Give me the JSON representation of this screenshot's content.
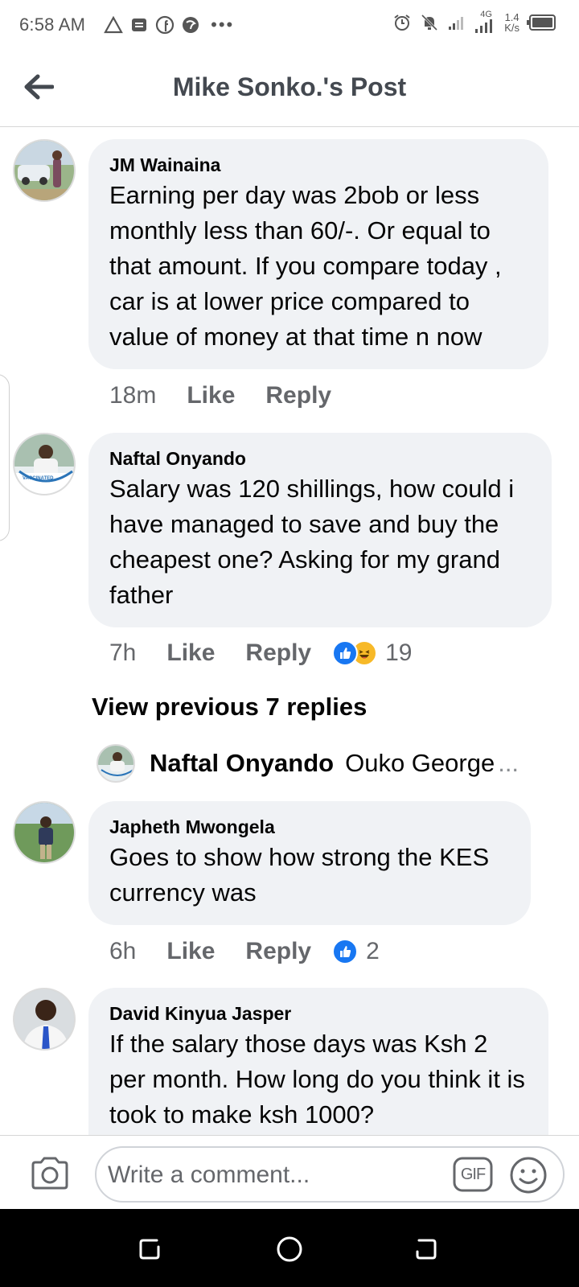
{
  "status_bar": {
    "time": "6:58 AM",
    "network": "4G",
    "speed_value": "1.4",
    "speed_unit": "K/s",
    "more": "•••"
  },
  "header": {
    "title": "Mike Sonko.'s Post"
  },
  "comments": [
    {
      "author": "JM Wainaina",
      "text": "Earning per day was 2bob or less monthly less than 60/-. Or equal to that amount. If you compare today , car is at lower price compared to value of money at that time n now",
      "time": "18m",
      "like_label": "Like",
      "reply_label": "Reply"
    },
    {
      "author": "Naftal Onyando",
      "text": "Salary was 120 shillings, how could i have managed to save and buy the cheapest one? Asking for my grand father",
      "time": "7h",
      "like_label": "Like",
      "reply_label": "Reply",
      "reaction_count": "19",
      "reactions": [
        "like-icon",
        "laugh-icon"
      ],
      "avatar_badge": "VACCINATED",
      "view_previous": "View previous 7 replies",
      "latest_reply": {
        "author": "Naftal Onyando",
        "text": "Ouko George",
        "ellipsis": "..."
      }
    },
    {
      "author": "Japheth Mwongela",
      "text": "Goes to show how strong the KES currency was",
      "time": "6h",
      "like_label": "Like",
      "reply_label": "Reply",
      "reaction_count": "2",
      "reactions": [
        "like-icon"
      ]
    },
    {
      "author": "David Kinyua Jasper",
      "text": "If the salary those days was Ksh 2 per month. How long do you think it is took to make ksh 1000?"
    }
  ],
  "composer": {
    "placeholder": "Write a comment...",
    "gif_label": "GIF"
  },
  "colors": {
    "bubble_bg": "#f0f2f5",
    "meta_text": "#65676b",
    "like_blue": "#1877f2",
    "laugh_yellow": "#f7b928"
  }
}
